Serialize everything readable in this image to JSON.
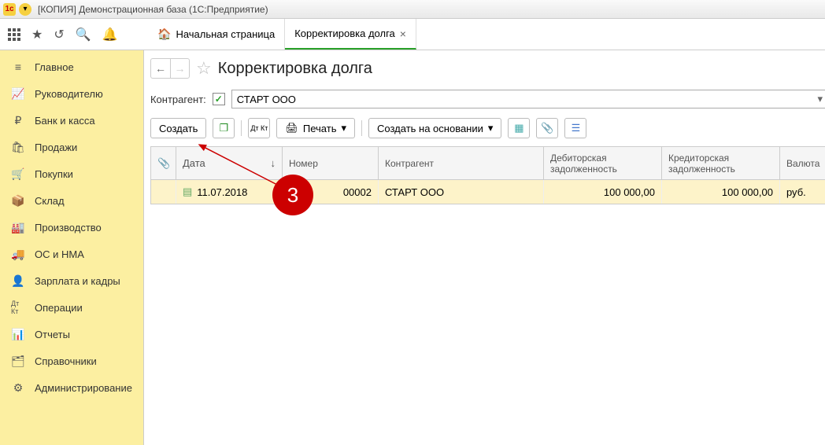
{
  "titlebar": {
    "title": "[КОПИЯ] Демонстрационная база  (1С:Предприятие)"
  },
  "tabs": {
    "home": "Начальная страница",
    "active": "Корректировка долга"
  },
  "sidebar": {
    "items": [
      "Главное",
      "Руководителю",
      "Банк и касса",
      "Продажи",
      "Покупки",
      "Склад",
      "Производство",
      "ОС и НМА",
      "Зарплата и кадры",
      "Операции",
      "Отчеты",
      "Справочники",
      "Администрирование"
    ]
  },
  "page": {
    "title": "Корректировка долга",
    "filter_label": "Контрагент:",
    "filter_value": "СТАРТ ООО",
    "btn_create": "Создать",
    "btn_print": "Печать",
    "btn_basedon": "Создать на основании",
    "dtk": "Дт Кт",
    "table": {
      "headers": {
        "date": "Дата",
        "number": "Номер",
        "kontr": "Контрагент",
        "deb": "Дебиторская задолженность",
        "kred": "Кредиторская задолженность",
        "val": "Валюта"
      },
      "row": {
        "date": "11.07.2018",
        "number": "00002",
        "kontr": "СТАРТ ООО",
        "deb": "100 000,00",
        "kred": "100 000,00",
        "val": "руб."
      }
    }
  },
  "annotation": {
    "num": "3"
  }
}
